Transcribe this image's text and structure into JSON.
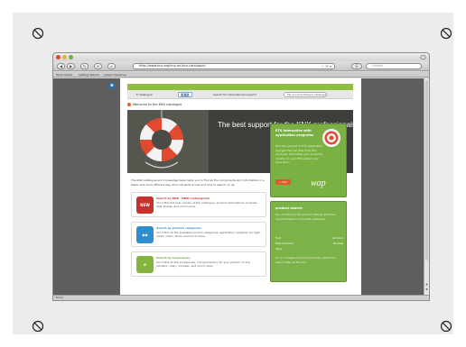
{
  "browser": {
    "url": "http://www.knx.org/knx-en/knx-catalogue/",
    "search_placeholder": "Google",
    "nav": {
      "back": "◀",
      "forward": "▶",
      "reload": "↻",
      "home": "⌂",
      "stop": "✕"
    },
    "url_icons": "☆ ⟳ ▾",
    "bookmarks": [
      "Most Visited",
      "Getting Started",
      "Latest Headlines"
    ],
    "status": "Done"
  },
  "page": {
    "side_logo": "e",
    "graybar": {
      "catalogue": "E catalogue",
      "knx_logo": "KNX",
      "support": "Search for international support",
      "search": "My account   Shared catalogue"
    },
    "welcome": "Welcome to the KNX catalogue",
    "hero_title": "The best support for the KNX professionals",
    "intro": "The KNX catalogue and knowledge base helps you to find all the components and information in a faster and more efficient way. Find out what is new and how to search on us.",
    "cards": [
      {
        "icon": "NEW",
        "title": "Search by KNX - NEW (redesigned)",
        "text": "You'll find the new version of the catalogue, product descriptions, pictures, data sheets, and much more.",
        "color": "#c8312c"
      },
      {
        "icon": "◆◆",
        "title": "Search by product categories",
        "text": "You'll find all the available product categories, application, systems, for light, audio, video, alarm and much more.",
        "color": "#2e8ecf"
      },
      {
        "icon": "✿",
        "title": "Search by accessories",
        "text": "You'll find all the accessories, complementary for your project, to any actuator, relay, modules, and much more.",
        "color": "#84b440"
      }
    ],
    "promo": {
      "title": "ETS interactive with application programs",
      "text": "Find the product in ETS application and get the real files from the producer. Download your products directly to your ETS project and save time.",
      "button": "» Info",
      "brand": "wap"
    },
    "product_search": {
      "title": "product search",
      "text": "You can find all the product listings and their documentation in the KNX catalogue.",
      "rows": [
        {
          "label": "Find",
          "value": "product"
        },
        {
          "label": "Manufacturer",
          "value": "Browse"
        },
        {
          "label": "Type",
          "value": ""
        }
      ],
      "footer": "For a complete list of all products, select the search filter at the top."
    }
  }
}
